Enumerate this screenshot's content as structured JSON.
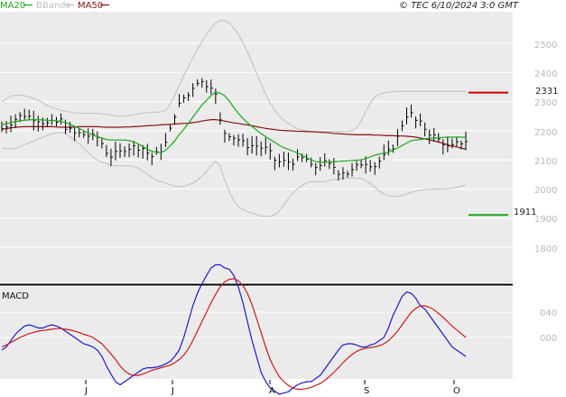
{
  "header": {
    "ma20_label": "MA20",
    "bbands_label": "BBands",
    "ma50_label": "MA50",
    "copyright": "© TEC 6/10/2024 3:0 GMT"
  },
  "colors": {
    "background": "#ffffff",
    "plot_bg": "#ebebeb",
    "grid": "#ffffff",
    "ma20": "#1aa81a",
    "bbands": "#c0c0c0",
    "ma50": "#8b1010",
    "price_bars": "#000000",
    "resistance": "#cc0000",
    "support": "#1aa81a",
    "macd": "#1a1acc",
    "signal": "#cc1a1a"
  },
  "price_axis": {
    "ticks": [
      "2500",
      "2400",
      "2300",
      "2200",
      "2100",
      "2000",
      "1900",
      "1800"
    ]
  },
  "macd_axis": {
    "ticks": [
      "040",
      "000"
    ]
  },
  "macd_title": "MACD",
  "months": [
    "J",
    "J",
    "A",
    "S",
    "O"
  ],
  "levels": {
    "resistance": {
      "label": "2331",
      "value": 2331
    },
    "support": {
      "label": "1911",
      "value": 1911
    }
  },
  "chart_data": {
    "type": "line",
    "title": "",
    "y_range": [
      1700,
      2590
    ],
    "macd_range": [
      -120,
      160
    ],
    "bars": 103,
    "series": [
      {
        "name": "MA20",
        "values": [
          2220,
          2224,
          2228,
          2232,
          2234,
          2236,
          2237,
          2238,
          2238,
          2237,
          2236,
          2235,
          2234,
          2232,
          2228,
          2222,
          2215,
          2208,
          2200,
          2192,
          2185,
          2180,
          2175,
          2170,
          2168,
          2168,
          2168,
          2168,
          2166,
          2162,
          2155,
          2146,
          2136,
          2130,
          2126,
          2125,
          2133,
          2148,
          2165,
          2186,
          2205,
          2225,
          2246,
          2268,
          2288,
          2305,
          2320,
          2333,
          2329,
          2320,
          2302,
          2280,
          2260,
          2242,
          2228,
          2215,
          2202,
          2190,
          2180,
          2170,
          2160,
          2150,
          2142,
          2136,
          2130,
          2124,
          2116,
          2108,
          2100,
          2094,
          2092,
          2092,
          2093,
          2094,
          2095,
          2096,
          2097,
          2098,
          2099,
          2100,
          2104,
          2110,
          2116,
          2120,
          2123,
          2127,
          2134,
          2141,
          2149,
          2158,
          2166,
          2168,
          2170,
          2172,
          2174,
          2175,
          2176,
          2177,
          2178,
          2178,
          2178,
          2178,
          2178
        ]
      },
      {
        "name": "MA50",
        "values": [
          2205,
          2207,
          2210,
          2212,
          2213,
          2214,
          2214,
          2214,
          2214,
          2214,
          2214,
          2214,
          2213,
          2212,
          2212,
          2212,
          2213,
          2214,
          2214,
          2214,
          2214,
          2214,
          2213,
          2212,
          2212,
          2212,
          2212,
          2213,
          2213,
          2214,
          2215,
          2216,
          2217,
          2218,
          2219,
          2220,
          2221,
          2222,
          2223,
          2224,
          2225,
          2226,
          2228,
          2230,
          2233,
          2236,
          2238,
          2238,
          2236,
          2233,
          2230,
          2227,
          2225,
          2222,
          2220,
          2217,
          2214,
          2211,
          2208,
          2206,
          2204,
          2202,
          2201,
          2200,
          2199,
          2198,
          2198,
          2197,
          2197,
          2196,
          2195,
          2194,
          2193,
          2191,
          2190,
          2189,
          2188,
          2187,
          2186,
          2186,
          2186,
          2186,
          2185,
          2185,
          2184,
          2183,
          2183,
          2182,
          2182,
          2181,
          2180,
          2178,
          2175,
          2172,
          2169,
          2165,
          2161,
          2157,
          2152,
          2147,
          2145,
          2140,
          2137
        ]
      },
      {
        "name": "BBands upper",
        "values": [
          2300,
          2310,
          2318,
          2322,
          2322,
          2320,
          2316,
          2310,
          2304,
          2296,
          2287,
          2280,
          2275,
          2270,
          2267,
          2264,
          2262,
          2261,
          2260,
          2260,
          2260,
          2259,
          2258,
          2256,
          2254,
          2252,
          2250,
          2250,
          2252,
          2255,
          2258,
          2260,
          2262,
          2263,
          2264,
          2265,
          2270,
          2290,
          2320,
          2356,
          2390,
          2420,
          2450,
          2478,
          2505,
          2530,
          2553,
          2570,
          2578,
          2578,
          2570,
          2553,
          2530,
          2502,
          2470,
          2435,
          2397,
          2360,
          2325,
          2295,
          2270,
          2250,
          2235,
          2225,
          2215,
          2208,
          2203,
          2200,
          2198,
          2197,
          2197,
          2197,
          2198,
          2198,
          2198,
          2198,
          2198,
          2200,
          2210,
          2235,
          2265,
          2295,
          2315,
          2325,
          2330,
          2332,
          2334,
          2335,
          2335,
          2335,
          2335,
          2335,
          2335,
          2335,
          2335,
          2335,
          2335,
          2335,
          2335,
          2335,
          2335,
          2335,
          2335
        ]
      },
      {
        "name": "BBands lower",
        "values": [
          2140,
          2138,
          2138,
          2140,
          2145,
          2152,
          2158,
          2166,
          2172,
          2178,
          2184,
          2190,
          2193,
          2195,
          2190,
          2180,
          2168,
          2155,
          2140,
          2125,
          2110,
          2100,
          2093,
          2087,
          2082,
          2080,
          2080,
          2080,
          2080,
          2077,
          2072,
          2062,
          2050,
          2040,
          2030,
          2025,
          2020,
          2015,
          2010,
          2008,
          2010,
          2015,
          2020,
          2030,
          2045,
          2060,
          2080,
          2095,
          2080,
          2030,
          1990,
          1960,
          1940,
          1930,
          1922,
          1918,
          1912,
          1908,
          1906,
          1906,
          1912,
          1925,
          1945,
          1968,
          1985,
          2000,
          2012,
          2020,
          2025,
          2025,
          2025,
          2025,
          2030,
          2033,
          2035,
          2037,
          2038,
          2038,
          2037,
          2036,
          2030,
          2020,
          2006,
          1993,
          1983,
          1977,
          1975,
          1975,
          1978,
          1983,
          1988,
          1993,
          1996,
          1998,
          1999,
          2000,
          2000,
          2000,
          2001,
          2003,
          2006,
          2010,
          2015
        ]
      }
    ],
    "macd": [
      -20,
      -15,
      -5,
      5,
      12,
      18,
      20,
      18,
      15,
      15,
      18,
      20,
      18,
      15,
      10,
      5,
      0,
      -5,
      -10,
      -12,
      -15,
      -20,
      -30,
      -45,
      -58,
      -70,
      -75,
      -70,
      -65,
      -60,
      -55,
      -50,
      -48,
      -48,
      -47,
      -45,
      -42,
      -38,
      -30,
      -20,
      0,
      25,
      50,
      70,
      85,
      98,
      110,
      115,
      115,
      110,
      108,
      98,
      80,
      55,
      25,
      -5,
      -30,
      -55,
      -70,
      -80,
      -85,
      -90,
      -88,
      -86,
      -80,
      -75,
      -72,
      -70,
      -70,
      -65,
      -60,
      -50,
      -40,
      -30,
      -20,
      -12,
      -10,
      -10,
      -12,
      -15,
      -15,
      -12,
      -10,
      -5,
      0,
      15,
      35,
      50,
      65,
      72,
      70,
      62,
      50,
      45,
      35,
      25,
      15,
      5,
      -5,
      -15,
      -20,
      -25,
      -30
    ],
    "macd_signal": [
      -15,
      -12,
      -8,
      -4,
      0,
      3,
      6,
      8,
      10,
      11,
      12,
      13,
      14,
      14,
      13,
      12,
      10,
      8,
      5,
      3,
      0,
      -5,
      -10,
      -18,
      -26,
      -35,
      -45,
      -53,
      -58,
      -60,
      -60,
      -58,
      -55,
      -52,
      -50,
      -48,
      -46,
      -44,
      -40,
      -35,
      -28,
      -18,
      -5,
      10,
      25,
      40,
      55,
      68,
      80,
      88,
      92,
      93,
      90,
      82,
      70,
      52,
      30,
      8,
      -15,
      -35,
      -50,
      -62,
      -70,
      -76,
      -80,
      -82,
      -82,
      -81,
      -79,
      -76,
      -73,
      -68,
      -62,
      -55,
      -48,
      -40,
      -33,
      -27,
      -22,
      -19,
      -17,
      -16,
      -15,
      -13,
      -10,
      -5,
      2,
      10,
      20,
      30,
      40,
      46,
      50,
      50,
      48,
      44,
      38,
      32,
      25,
      18,
      12,
      6,
      0
    ]
  }
}
